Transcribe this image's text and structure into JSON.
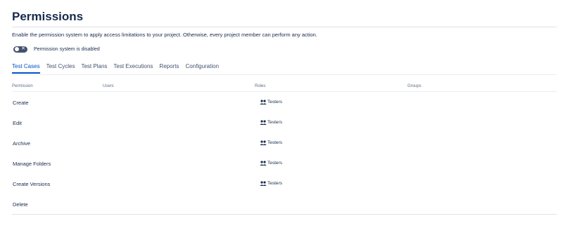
{
  "page": {
    "title": "Permissions",
    "description": "Enable the permission system to apply access limitations to your project. Otherwise, every project member can perform any action.",
    "toggle": {
      "label": "Permission system is disabled",
      "enabled": false,
      "off_glyph": "✕"
    }
  },
  "tabs": [
    {
      "label": "Test Cases",
      "active": true
    },
    {
      "label": "Test Cycles",
      "active": false
    },
    {
      "label": "Test Plans",
      "active": false
    },
    {
      "label": "Test Executions",
      "active": false
    },
    {
      "label": "Reports",
      "active": false
    },
    {
      "label": "Configuration",
      "active": false
    }
  ],
  "table": {
    "headers": {
      "permission": "Permission",
      "users": "Users",
      "roles": "Roles",
      "groups": "Groups"
    },
    "rows": [
      {
        "permission": "Create",
        "role": "Testers",
        "role_icon": "people-icon"
      },
      {
        "permission": "Edit",
        "role": "Testers",
        "role_icon": "people-icon"
      },
      {
        "permission": "Archive",
        "role": "Testers",
        "role_icon": "people-icon"
      },
      {
        "permission": "Manage Folders",
        "role": "Testers",
        "role_icon": "people-icon"
      },
      {
        "permission": "Create Versions",
        "role": "Testers",
        "role_icon": "people-icon"
      },
      {
        "permission": "Delete",
        "role": "",
        "role_icon": ""
      }
    ]
  },
  "colors": {
    "text": "#172b4d",
    "accent": "#0052cc",
    "toggle_off": "#42526e",
    "muted": "#5e6c84"
  }
}
